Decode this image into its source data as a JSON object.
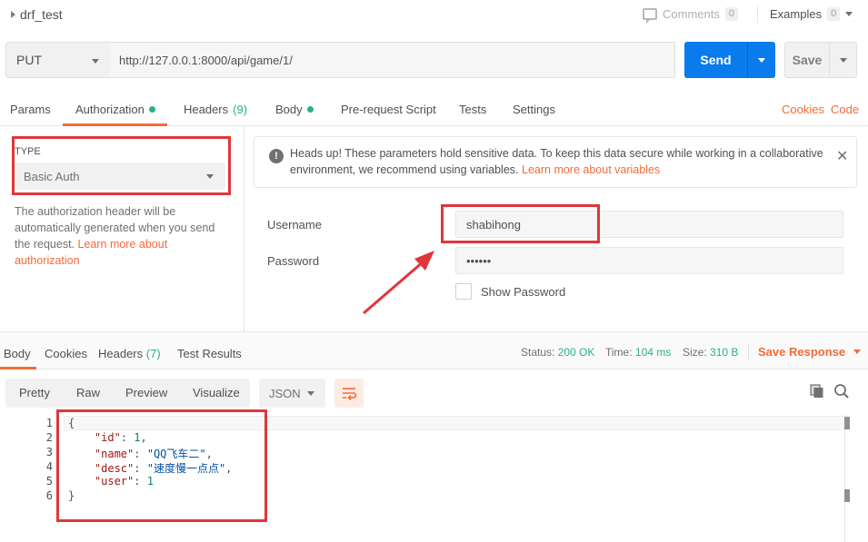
{
  "header": {
    "request_name": "drf_test",
    "comments_label": "Comments",
    "comments_count": "0",
    "examples_label": "Examples",
    "examples_count": "0"
  },
  "request": {
    "method": "PUT",
    "url": "http://127.0.0.1:8000/api/game/1/",
    "send_label": "Send",
    "save_label": "Save"
  },
  "tabs": {
    "params": "Params",
    "authorization": "Authorization",
    "headers": "Headers",
    "headers_count": "(9)",
    "body": "Body",
    "prerequest": "Pre-request Script",
    "tests": "Tests",
    "settings": "Settings",
    "cookies": "Cookies",
    "code": "Code"
  },
  "auth": {
    "type_label": "TYPE",
    "type_value": "Basic Auth",
    "description": "The authorization header will be automatically generated when you send the request.",
    "learn_more": "Learn more about authorization",
    "alert_text": "Heads up! These parameters hold sensitive data. To keep this data secure while working in a collaborative environment, we recommend using variables.",
    "alert_link": "Learn more about variables",
    "username_label": "Username",
    "username_value": "shabihong",
    "password_label": "Password",
    "password_value": "••••••",
    "show_password": "Show Password"
  },
  "response": {
    "tabs": {
      "body": "Body",
      "cookies": "Cookies",
      "headers": "Headers",
      "headers_count": "(7)",
      "test_results": "Test Results"
    },
    "status_label": "Status:",
    "status_value": "200 OK",
    "time_label": "Time:",
    "time_value": "104 ms",
    "size_label": "Size:",
    "size_value": "310 B",
    "save_response": "Save Response",
    "views": {
      "pretty": "Pretty",
      "raw": "Raw",
      "preview": "Preview",
      "visualize": "Visualize"
    },
    "format": "JSON",
    "code_lines": [
      "{",
      "    \"id\": 1,",
      "    \"name\": \"QQ飞车二\",",
      "    \"desc\": \"速度慢一点点\",",
      "    \"user\": 1",
      "}"
    ],
    "line_numbers": [
      "1",
      "2",
      "3",
      "4",
      "5",
      "6"
    ]
  },
  "colors": {
    "accent": "#f26b3a",
    "send_blue": "#097bed",
    "status_green": "#26b47f",
    "highlight_red": "#e0363a"
  }
}
